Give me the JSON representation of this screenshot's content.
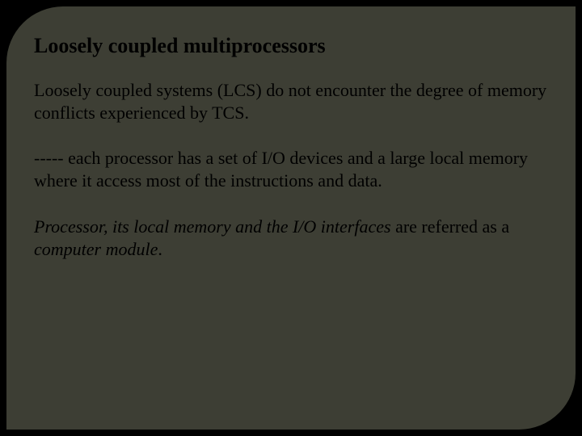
{
  "slide": {
    "heading": "Loosely coupled multiprocessors",
    "p1": "Loosely coupled systems (LCS) do not encounter the degree of memory conflicts experienced by TCS.",
    "p2": "----- each processor has a set of I/O devices and a large local memory where it access most of the instructions and data.",
    "p3_italic1": "Processor, its local memory and the I/O interfaces",
    "p3_plain1": " are referred as a ",
    "p3_italic2": "computer module",
    "p3_plain2": "."
  }
}
